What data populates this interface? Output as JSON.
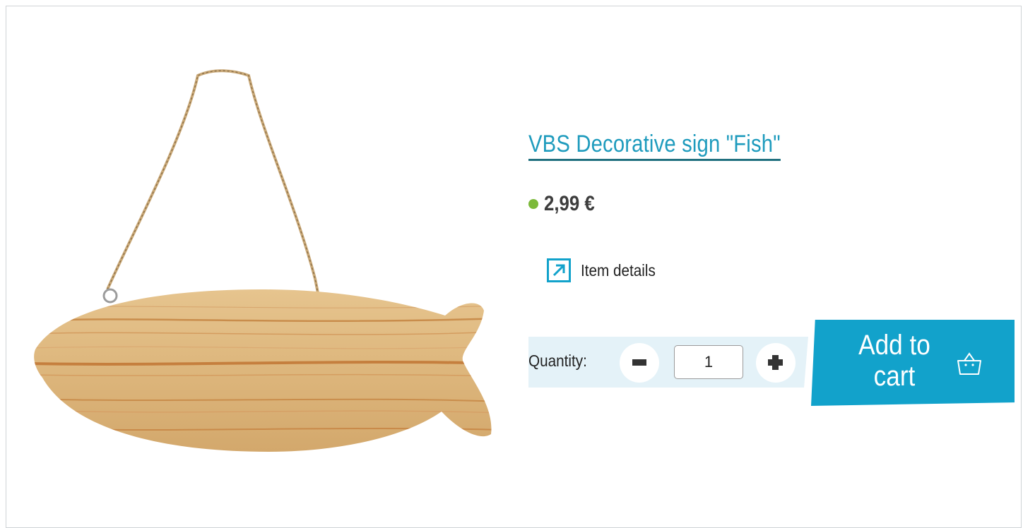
{
  "product": {
    "title": "VBS Decorative sign \"Fish\"",
    "price": "2,99 €",
    "image_alt": "Wooden fish-shaped decorative sign hanging on a jute cord"
  },
  "details_link": {
    "label": "Item details",
    "icon": "external-arrow-icon"
  },
  "quantity": {
    "label": "Quantity:",
    "value": "1",
    "minus_icon": "minus-icon",
    "plus_icon": "plus-icon"
  },
  "cart": {
    "label_line1": "Add to",
    "label_line2": "cart",
    "icon": "basket-icon"
  },
  "colors": {
    "accent": "#12a2cb",
    "title": "#1e9bbd",
    "title_underline": "#21707f",
    "availability": "#7cb93a",
    "quantity_panel": "#e4f2f8"
  }
}
